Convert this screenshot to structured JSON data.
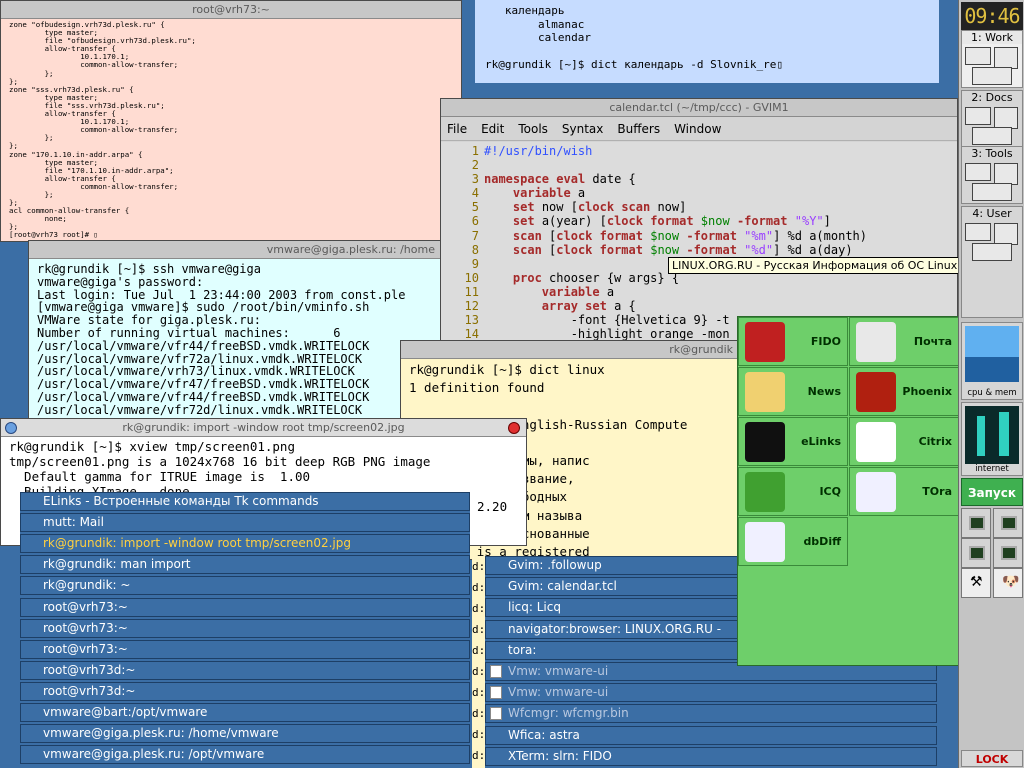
{
  "zone_window": {
    "title": "root@vrh73:~",
    "lines": [
      "zone \"ofbudesign.vrh73d.plesk.ru\" {",
      "        type master;",
      "        file \"ofbudesign.vrh73d.plesk.ru\";",
      "        allow-transfer {",
      "                10.1.170.1;",
      "                common-allow-transfer;",
      "        };",
      "};",
      "zone \"sss.vrh73d.plesk.ru\" {",
      "        type master;",
      "        file \"sss.vrh73d.plesk.ru\";",
      "        allow-transfer {",
      "                10.1.170.1;",
      "                common-allow-transfer;",
      "        };",
      "};",
      "zone \"170.1.10.in-addr.arpa\" {",
      "        type master;",
      "        file \"170.1.10.in-addr.arpa\";",
      "        allow-transfer {",
      "                common-allow-transfer;",
      "        };",
      "};",
      "acl common-allow-transfer {",
      "        none;",
      "};",
      "[root@vrh73 root]# "
    ]
  },
  "dict_top": {
    "lines": [
      "   календарь",
      "        almanac",
      "        calendar",
      "",
      "rk@grundik [~]$ dict календарь -d Slovnik_re"
    ]
  },
  "vmware_window": {
    "title": "vmware@giga.plesk.ru: /home",
    "lines": [
      "rk@grundik [~]$ ssh vmware@giga",
      "vmware@giga's password:",
      "Last login: Tue Jul  1 23:44:00 2003 from const.ple",
      "[vmware@giga vmware]$ sudo /root/bin/vminfo.sh",
      "VMWare state for giga.plesk.ru:",
      "Number of running virtual machines:      6",
      "/usr/local/vmware/vfr44/freeBSD.vmdk.WRITELOCK",
      "/usr/local/vmware/vfr72a/linux.vmdk.WRITELOCK",
      "/usr/local/vmware/vrh73/linux.vmdk.WRITELOCK",
      "/usr/local/vmware/vfr47/freeBSD.vmdk.WRITELOCK",
      "/usr/local/vmware/vfr44/freeBSD.vmdk.WRITELOCK",
      "/usr/local/vmware/vfr72d/linux.vmdk.WRITELOCK"
    ]
  },
  "gvim": {
    "title": "calendar.tcl (~/tmp/ccc) - GVIM1",
    "menu": [
      "File",
      "Edit",
      "Tools",
      "Syntax",
      "Buffers",
      "Window"
    ],
    "line_numbers": [
      "1",
      "2",
      "3",
      "4",
      "5",
      "6",
      "7",
      "8",
      "9",
      "10",
      "11",
      "12",
      "13",
      "14"
    ],
    "code": [
      "#!/usr/bin/wish",
      "",
      "namespace eval date {",
      "    variable a",
      "    set now [clock scan now]",
      "    set a(year) [clock format $now -format \"%Y\"]",
      "    scan [clock format $now -format \"%m\"] %d a(month)",
      "    scan [clock format $now -format \"%d\"] %d a(day)",
      "",
      "    proc chooser {w args} {",
      "        variable a",
      "        array set a {",
      "            -font {Helvetica 9} -t",
      "            -highlight orange -mon"
    ]
  },
  "tooltip": "LINUX.ORG.RU - Русская Информация об ОС Linux - Phoenix",
  "dict_linux": {
    "title": "rk@grundik",
    "lines": [
      "rk@grundik [~]$ dict linux",
      "1 definition found",
      "",
      "From The Open English-Russian Compute",
      "",
      "рационной системы, напис",
      "Торвальдсом; название,",
      "ся символом свободных",
      ", часто Linux'ом называ",
      "нные системы, основанные",
      "x; Linux is a registered"
    ]
  },
  "xview": {
    "title": "rk@grundik: import -window root tmp/screen02.jpg",
    "lines": [
      "rk@grundik [~]$ xview tmp/screen01.png",
      "tmp/screen01.png is a 1024x768 16 bit deep RGB PNG image",
      "  Default gamma for ITRUE image is  1.00",
      "  Building XImage...done"
    ],
    "side_text": "2.20"
  },
  "window_list_left": [
    {
      "label": "ELinks - Встроенные команды Tk commands",
      "state": "normal"
    },
    {
      "label": "mutt: Mail",
      "state": "normal"
    },
    {
      "label": "rk@grundik: import -window root tmp/screen02.jpg",
      "state": "active"
    },
    {
      "label": "rk@grundik: man import",
      "state": "normal"
    },
    {
      "label": "rk@grundik: ~",
      "state": "normal"
    },
    {
      "label": "root@vrh73:~",
      "state": "normal"
    },
    {
      "label": "root@vrh73:~",
      "state": "normal"
    },
    {
      "label": "root@vrh73:~",
      "state": "normal"
    },
    {
      "label": "root@vrh73d:~",
      "state": "normal"
    },
    {
      "label": "root@vrh73d:~",
      "state": "normal"
    },
    {
      "label": "vmware@bart:/opt/vmware",
      "state": "normal"
    },
    {
      "label": "vmware@giga.plesk.ru: /home/vmware",
      "state": "normal"
    },
    {
      "label": "vmware@giga.plesk.ru: /opt/vmware",
      "state": "normal"
    }
  ],
  "window_list_right": [
    {
      "label": "Gvim: .followup",
      "state": "normal",
      "icon": ""
    },
    {
      "label": "Gvim: calendar.tcl",
      "state": "normal",
      "icon": ""
    },
    {
      "label": "licq: Licq",
      "state": "normal",
      "icon": ""
    },
    {
      "label": "navigator:browser: LINUX.ORG.RU -",
      "state": "normal",
      "icon": ""
    },
    {
      "label": "tora:",
      "state": "normal",
      "icon": ""
    },
    {
      "label": "Vmw: vmware-ui",
      "state": "dim",
      "icon": "doc"
    },
    {
      "label": "Vmw: vmware-ui",
      "state": "dim",
      "icon": "doc"
    },
    {
      "label": "Wfcmgr: wfcmgr.bin",
      "state": "dim",
      "icon": "ica"
    },
    {
      "label": "Wfica: astra",
      "state": "normal",
      "icon": ""
    },
    {
      "label": "XTerm: slrn: FIDO",
      "state": "normal",
      "icon": ""
    }
  ],
  "d_column": [
    "d:",
    "d:",
    "d:",
    "d:",
    "d:",
    "d:",
    "d:",
    "d:",
    "d:",
    "d:"
  ],
  "launcher": [
    {
      "label": "FIDO",
      "color": "#c02020"
    },
    {
      "label": "Почта",
      "color": "#e8e8e8"
    },
    {
      "label": "News",
      "color": "#f0d070"
    },
    {
      "label": "Phoenix",
      "color": "#b02010"
    },
    {
      "label": "eLinks",
      "color": "#101010"
    },
    {
      "label": "Citrix",
      "color": "#ffffff"
    },
    {
      "label": "ICQ",
      "color": "#40a030"
    },
    {
      "label": "TOra",
      "color": "#f0f0ff"
    },
    {
      "label": "dbDiff",
      "color": "#f0f0ff"
    }
  ],
  "panel": {
    "clock": "09:46",
    "desktops": [
      "1: Work",
      "2: Docs",
      "3: Tools",
      "4: User"
    ],
    "monitor1_label": "cpu & mem",
    "monitor2_label": "internet",
    "start_label": "Запуск",
    "lock_label": "LOCK"
  },
  "colors": {
    "desktop_bg": "#3b6ea5",
    "launcher_bg": "#6ecf6a",
    "active_item": "#ffd040",
    "start_button": "#3fb050"
  }
}
